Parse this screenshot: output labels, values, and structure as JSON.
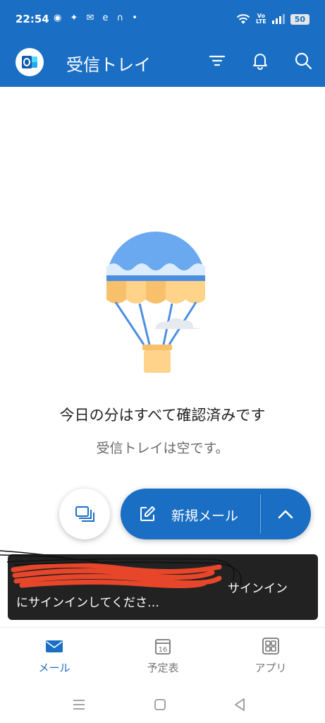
{
  "status_bar": {
    "time": "22:54",
    "notification_icons": "◉ ✦ ✉ e ∩ •",
    "volte": "Vo\nLTE",
    "battery": "50"
  },
  "header": {
    "title": "受信トレイ",
    "icons": [
      "outlook-logo-icon",
      "filter-icon",
      "bell-icon",
      "search-icon"
    ]
  },
  "empty_state": {
    "illustration": "hot-air-balloon",
    "title": "今日の分はすべて確認済みです",
    "subtitle": "受信トレイは空です。"
  },
  "fab": {
    "compose_label": "新規メール",
    "secondary_icon": "stack-icon",
    "expand_icon": "chevron-up-icon"
  },
  "snackbar": {
    "message": "にサインインしてくださ…",
    "action": "サインイン"
  },
  "bottom_nav": {
    "items": [
      {
        "label": "メール",
        "icon": "mail-icon",
        "active": true
      },
      {
        "label": "予定表",
        "icon": "calendar-icon",
        "active": false,
        "day": "16"
      },
      {
        "label": "アプリ",
        "icon": "apps-icon",
        "active": false
      }
    ]
  },
  "colors": {
    "brand": "#1A6FC4",
    "snackbar": "#222222",
    "balloon_blue": "#6AA8F0",
    "balloon_yellow": "#FFD38A"
  }
}
